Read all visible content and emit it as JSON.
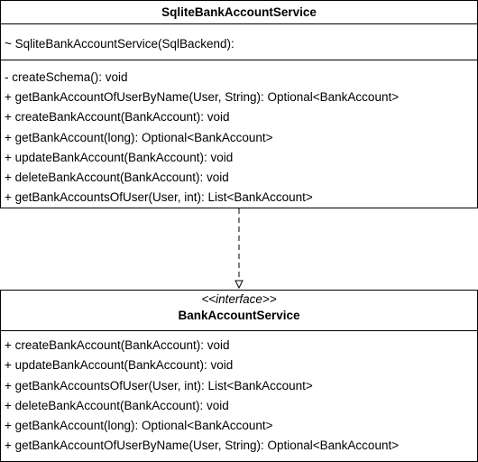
{
  "implementation_class": {
    "name": "SqliteBankAccountService",
    "constructors": [
      "~ SqliteBankAccountService(SqlBackend):"
    ],
    "methods": [
      "- createSchema(): void",
      "+ getBankAccountOfUserByName(User, String): Optional<BankAccount>",
      "+ createBankAccount(BankAccount): void",
      "+ getBankAccount(long): Optional<BankAccount>",
      "+ updateBankAccount(BankAccount): void",
      "+ deleteBankAccount(BankAccount): void",
      "+ getBankAccountsOfUser(User, int): List<BankAccount>"
    ]
  },
  "interface_class": {
    "stereotype": "<<interface>>",
    "name": "BankAccountService",
    "methods": [
      "+ createBankAccount(BankAccount): void",
      "+ updateBankAccount(BankAccount): void",
      "+ getBankAccountsOfUser(User, int): List<BankAccount>",
      "+ deleteBankAccount(BankAccount): void",
      "+ getBankAccount(long): Optional<BankAccount>",
      "+ getBankAccountOfUserByName(User, String): Optional<BankAccount>"
    ]
  },
  "relationship": {
    "type": "realization",
    "line_style": "dashed",
    "arrowhead": "hollow-triangle",
    "color": "#000000"
  }
}
